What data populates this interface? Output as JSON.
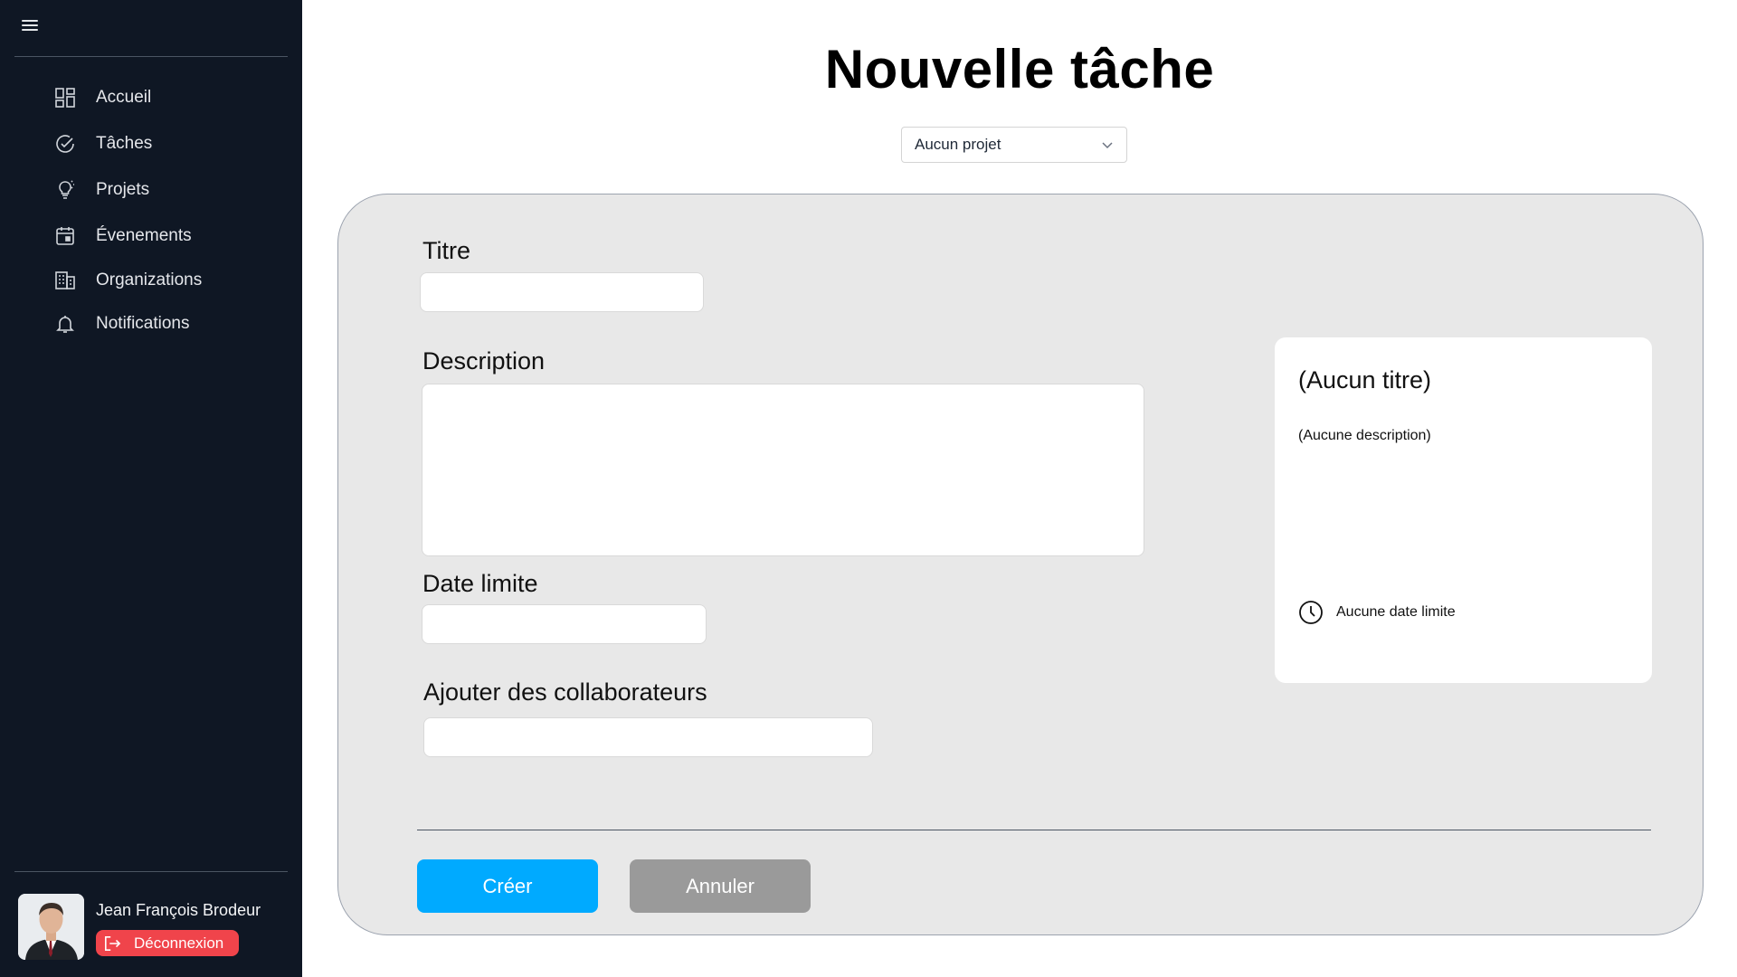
{
  "sidebar": {
    "menu_icon": "hamburger-icon",
    "items": [
      {
        "label": "Accueil",
        "icon": "dashboard-grid-icon"
      },
      {
        "label": "Tâches",
        "icon": "check-circle-icon"
      },
      {
        "label": "Projets",
        "icon": "lightbulb-icon"
      },
      {
        "label": "Évenements",
        "icon": "calendar-icon"
      },
      {
        "label": "Organizations",
        "icon": "building-icon"
      },
      {
        "label": "Notifications",
        "icon": "bell-icon"
      }
    ],
    "user": {
      "name": "Jean François Brodeur",
      "logout_label": "Déconnexion"
    }
  },
  "main": {
    "title": "Nouvelle tâche",
    "project_select": {
      "value": "Aucun projet"
    },
    "form": {
      "title_label": "Titre",
      "title_value": "",
      "description_label": "Description",
      "description_value": "",
      "deadline_label": "Date limite",
      "deadline_value": "",
      "collaborators_label": "Ajouter des collaborateurs",
      "collaborators_value": ""
    },
    "preview": {
      "title": "(Aucun titre)",
      "description": "(Aucune description)",
      "deadline": "Aucune date limite"
    },
    "buttons": {
      "create": "Créer",
      "cancel": "Annuler"
    }
  },
  "colors": {
    "sidebar_bg": "#0f1724",
    "create_button": "#00aaff",
    "cancel_button": "#9a9a9a",
    "logout_button": "#f0444b",
    "panel_bg": "#e8e8e8"
  }
}
